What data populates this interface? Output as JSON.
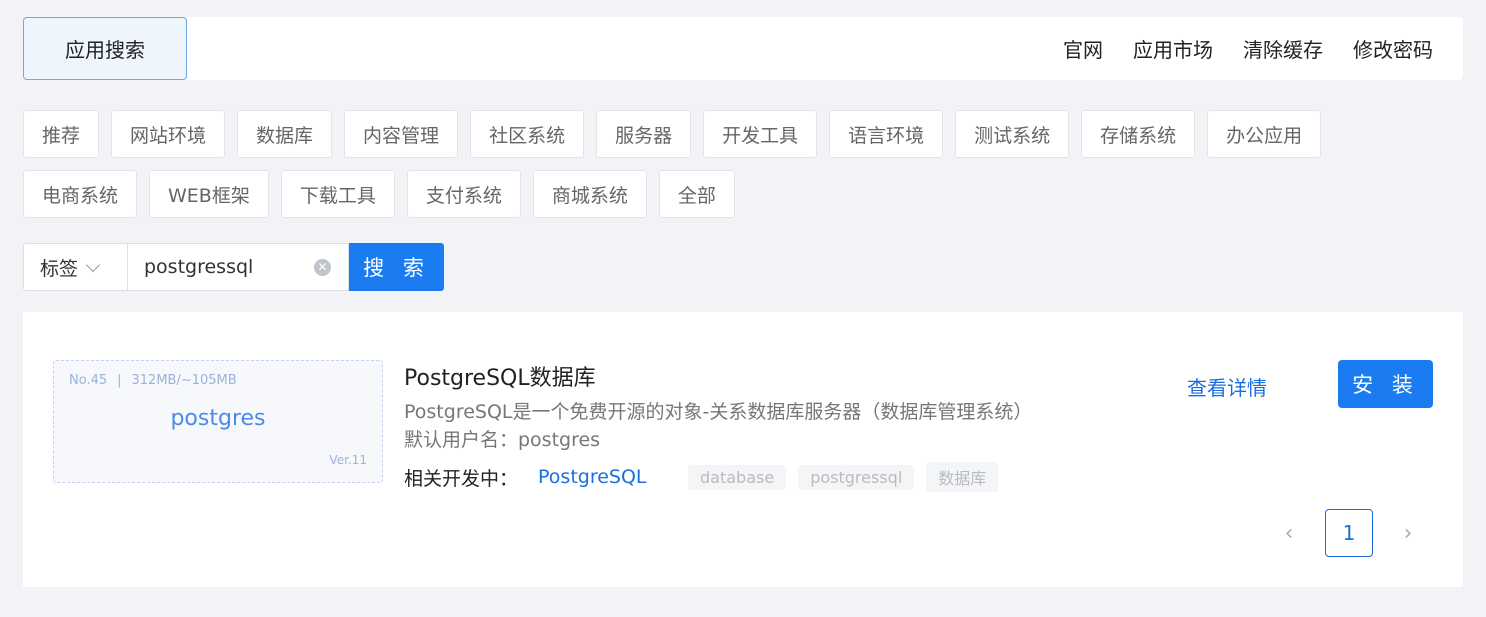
{
  "header": {
    "active_tab": "应用搜索",
    "nav": [
      "官网",
      "应用市场",
      "清除缓存",
      "修改密码"
    ]
  },
  "categories": {
    "row1": [
      "推荐",
      "网站环境",
      "数据库",
      "内容管理",
      "社区系统",
      "服务器",
      "开发工具",
      "语言环境",
      "测试系统",
      "存储系统",
      "办公应用"
    ],
    "row2": [
      "电商系统",
      "WEB框架",
      "下载工具",
      "支付系统",
      "商城系统",
      "全部"
    ]
  },
  "search": {
    "filter_label": "标签",
    "query": "postgressql",
    "button_label": "搜 索"
  },
  "result": {
    "number": "No.45",
    "size": "312MB/~105MB",
    "card_name": "postgres",
    "version": "Ver.11",
    "title": "PostgreSQL数据库",
    "description": "PostgreSQL是一个免费开源的对象-关系数据库服务器（数据库管理系统）",
    "default_user": "默认用户名：postgres",
    "dev_label": "相关开发中：",
    "dev_link": "PostgreSQL",
    "tags": [
      "database",
      "postgressql",
      "数据库"
    ],
    "detail_label": "查看详情",
    "install_label": "安 装"
  },
  "pagination": {
    "current": "1",
    "prev_icon": "chevron-left-icon",
    "next_icon": "chevron-right-icon"
  },
  "colors": {
    "accent": "#1a7cf0",
    "link": "#1a6fe0",
    "background": "#f2f3f7"
  }
}
